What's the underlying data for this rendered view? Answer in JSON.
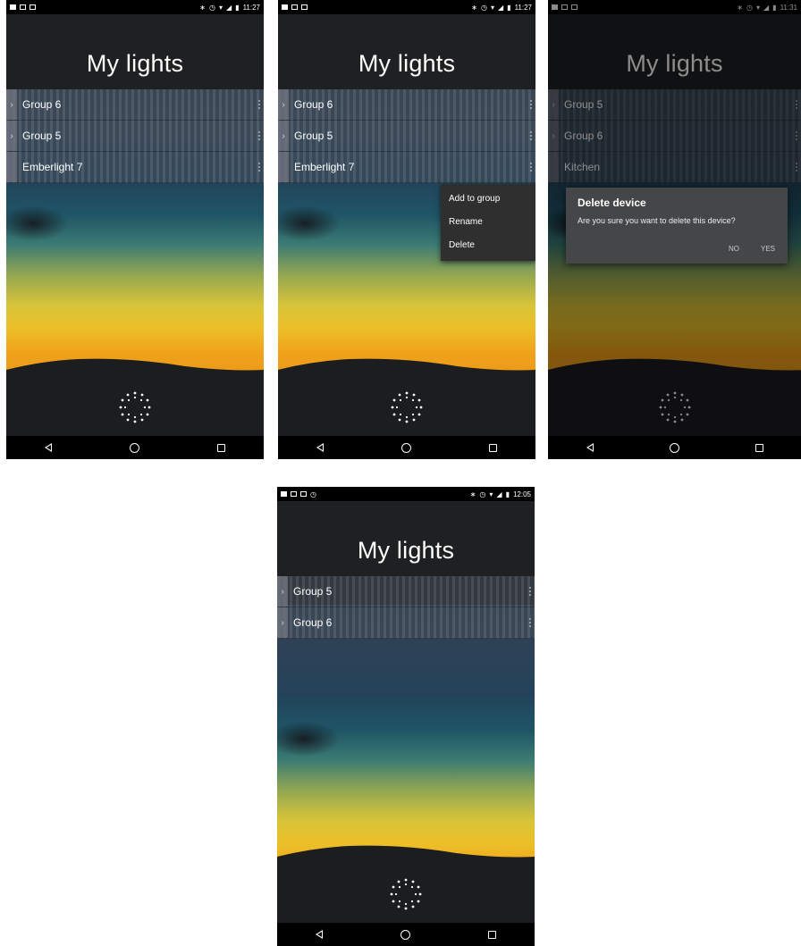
{
  "screens": [
    {
      "status": {
        "time": "11:27"
      },
      "title": "My lights",
      "rows": [
        {
          "label": "Group 6"
        },
        {
          "label": "Group 5"
        },
        {
          "label": "Emberlight 7"
        }
      ]
    },
    {
      "status": {
        "time": "11:27"
      },
      "title": "My lights",
      "rows": [
        {
          "label": "Group 6"
        },
        {
          "label": "Group 5"
        },
        {
          "label": "Emberlight 7"
        }
      ],
      "menu": [
        "Add to group",
        "Rename",
        "Delete"
      ]
    },
    {
      "status": {
        "time": "11:31"
      },
      "title": "My lights",
      "rows": [
        {
          "label": "Group 5"
        },
        {
          "label": "Group 6"
        },
        {
          "label": "Kitchen"
        }
      ],
      "dialog": {
        "title": "Delete device",
        "message": "Are you sure you want to delete this device?",
        "no": "NO",
        "yes": "YES"
      }
    },
    {
      "status": {
        "time": "12:05"
      },
      "title": "My lights",
      "rows": [
        {
          "label": "Group 5"
        },
        {
          "label": "Group 6"
        }
      ]
    }
  ],
  "icons": {
    "row_expand": "chevron-right-icon",
    "row_more": "more-vert-icon",
    "sun_button": "sun-icon",
    "nav_back": "back-icon",
    "nav_home": "home-icon",
    "nav_recent": "recent-apps-icon"
  }
}
